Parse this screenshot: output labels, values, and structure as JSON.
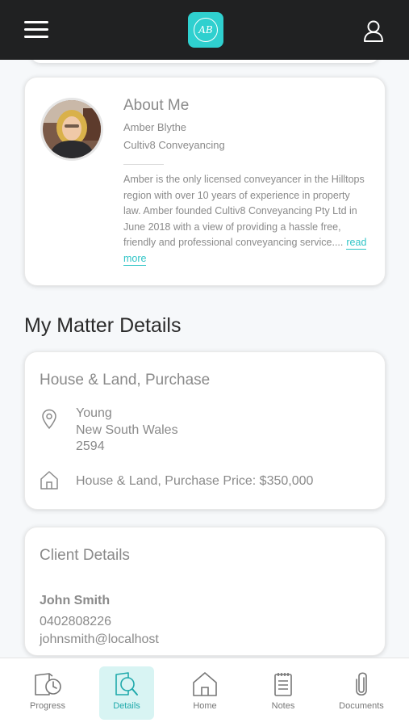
{
  "header": {
    "logo_text": "AB",
    "colors": {
      "bar": "#202122",
      "accent": "#2fd0cf"
    },
    "icons": [
      "menu-icon",
      "logo",
      "user-icon"
    ]
  },
  "about": {
    "title": "About Me",
    "name": "Amber Blythe",
    "company": "Cultiv8 Conveyancing",
    "bio": "Amber is the only licensed conveyancer in the Hilltops region with over 10 years of experience in property law. Amber founded Cultiv8 Conveyancing Pty Ltd in June 2018 with a view of providing a hassle free, friendly and professional conveyancing service....",
    "read_more": "read more"
  },
  "matter": {
    "section_title": "My Matter Details",
    "heading": "House & Land, Purchase",
    "address_line1": "Young",
    "address_line2": "New South Wales",
    "address_line3": "2594",
    "price_text": "House & Land, Purchase Price: $350,000"
  },
  "client": {
    "heading": "Client Details",
    "name": "John Smith",
    "phone": "0402808226",
    "email": "johnsmith@localhost"
  },
  "nav": {
    "active": "Details",
    "items": [
      {
        "label": "Progress",
        "icon": "progress-icon"
      },
      {
        "label": "Details",
        "icon": "details-icon"
      },
      {
        "label": "Home",
        "icon": "home-icon"
      },
      {
        "label": "Notes",
        "icon": "notes-icon"
      },
      {
        "label": "Documents",
        "icon": "paperclip-icon"
      }
    ]
  }
}
